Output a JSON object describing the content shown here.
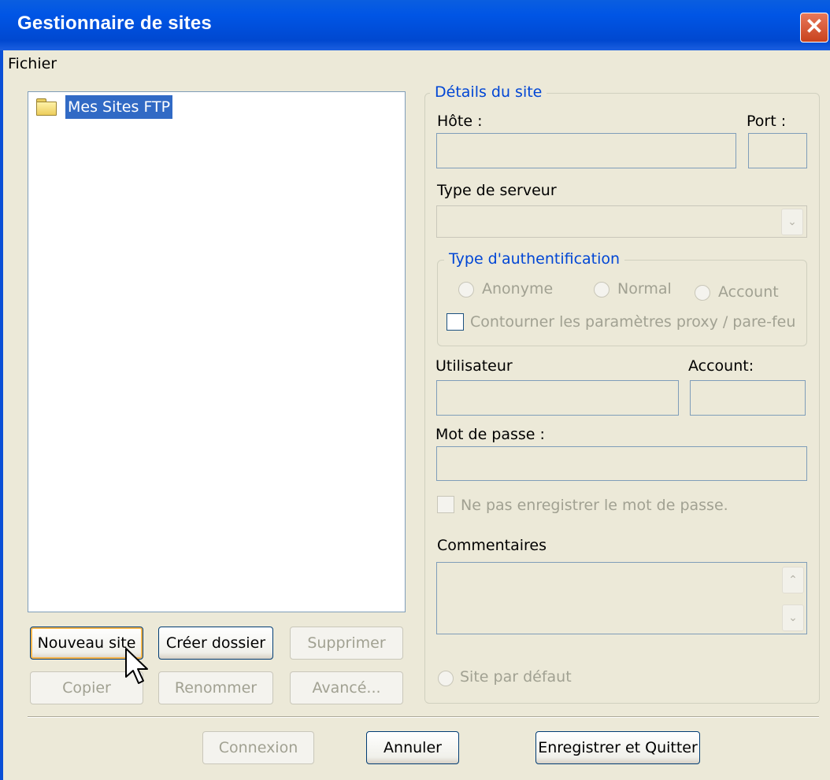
{
  "window": {
    "title": "Gestionnaire de sites",
    "close_icon": "close-icon"
  },
  "menu": {
    "items": [
      "Fichier"
    ]
  },
  "tree": {
    "root_label": "Mes Sites FTP",
    "root_icon": "folder-icon"
  },
  "left_buttons": {
    "new_site": "Nouveau site",
    "new_folder": "Créer dossier",
    "delete": "Supprimer",
    "copy": "Copier",
    "rename": "Renommer",
    "advanced": "Avancé..."
  },
  "details": {
    "legend": "Détails du site",
    "host_label": "Hôte :",
    "host_value": "",
    "port_label": "Port :",
    "port_value": "",
    "server_type_label": "Type de serveur",
    "server_type_value": "",
    "auth": {
      "legend": "Type d'authentification",
      "anonymous": "Anonyme",
      "normal": "Normal",
      "account": "Account",
      "bypass_proxy": "Contourner les paramètres proxy / pare-feu"
    },
    "user_label": "Utilisateur",
    "user_value": "",
    "account_label": "Account:",
    "account_value": "",
    "password_label": "Mot de passe :",
    "password_value": "",
    "dont_save_password": "Ne pas enregistrer le mot de passe.",
    "comments_label": "Commentaires",
    "comments_value": "",
    "default_site": "Site par défaut"
  },
  "footer": {
    "connect": "Connexion",
    "cancel": "Annuler",
    "save_quit": "Enregistrer et Quitter"
  },
  "colors": {
    "titlebar": "#0055e5",
    "dialog_bg": "#ece9d8",
    "selection": "#316ac5",
    "group_legend": "#0046d5"
  }
}
